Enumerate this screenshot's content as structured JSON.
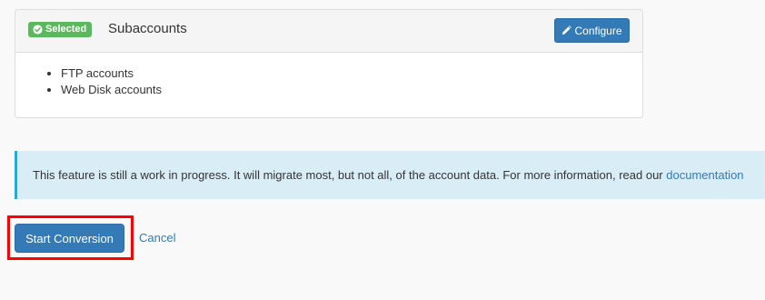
{
  "panel": {
    "badge_label": "Selected",
    "badge_icon": "check-circle-icon",
    "title": "Subaccounts",
    "configure_label": "Configure",
    "configure_icon": "pencil-icon",
    "items": [
      "FTP accounts",
      "Web Disk accounts"
    ]
  },
  "alert": {
    "text": "This feature is still a work in progress. It will migrate most, but not all, of the account data. For more information, read our ",
    "link_label": "documentation"
  },
  "actions": {
    "start_label": "Start Conversion",
    "cancel_label": "Cancel"
  },
  "colors": {
    "primary": "#337ab7",
    "success": "#5cb85c",
    "info_bg": "#d9edf7",
    "info_border": "#2aa7d6",
    "highlight": "#ff0000"
  }
}
